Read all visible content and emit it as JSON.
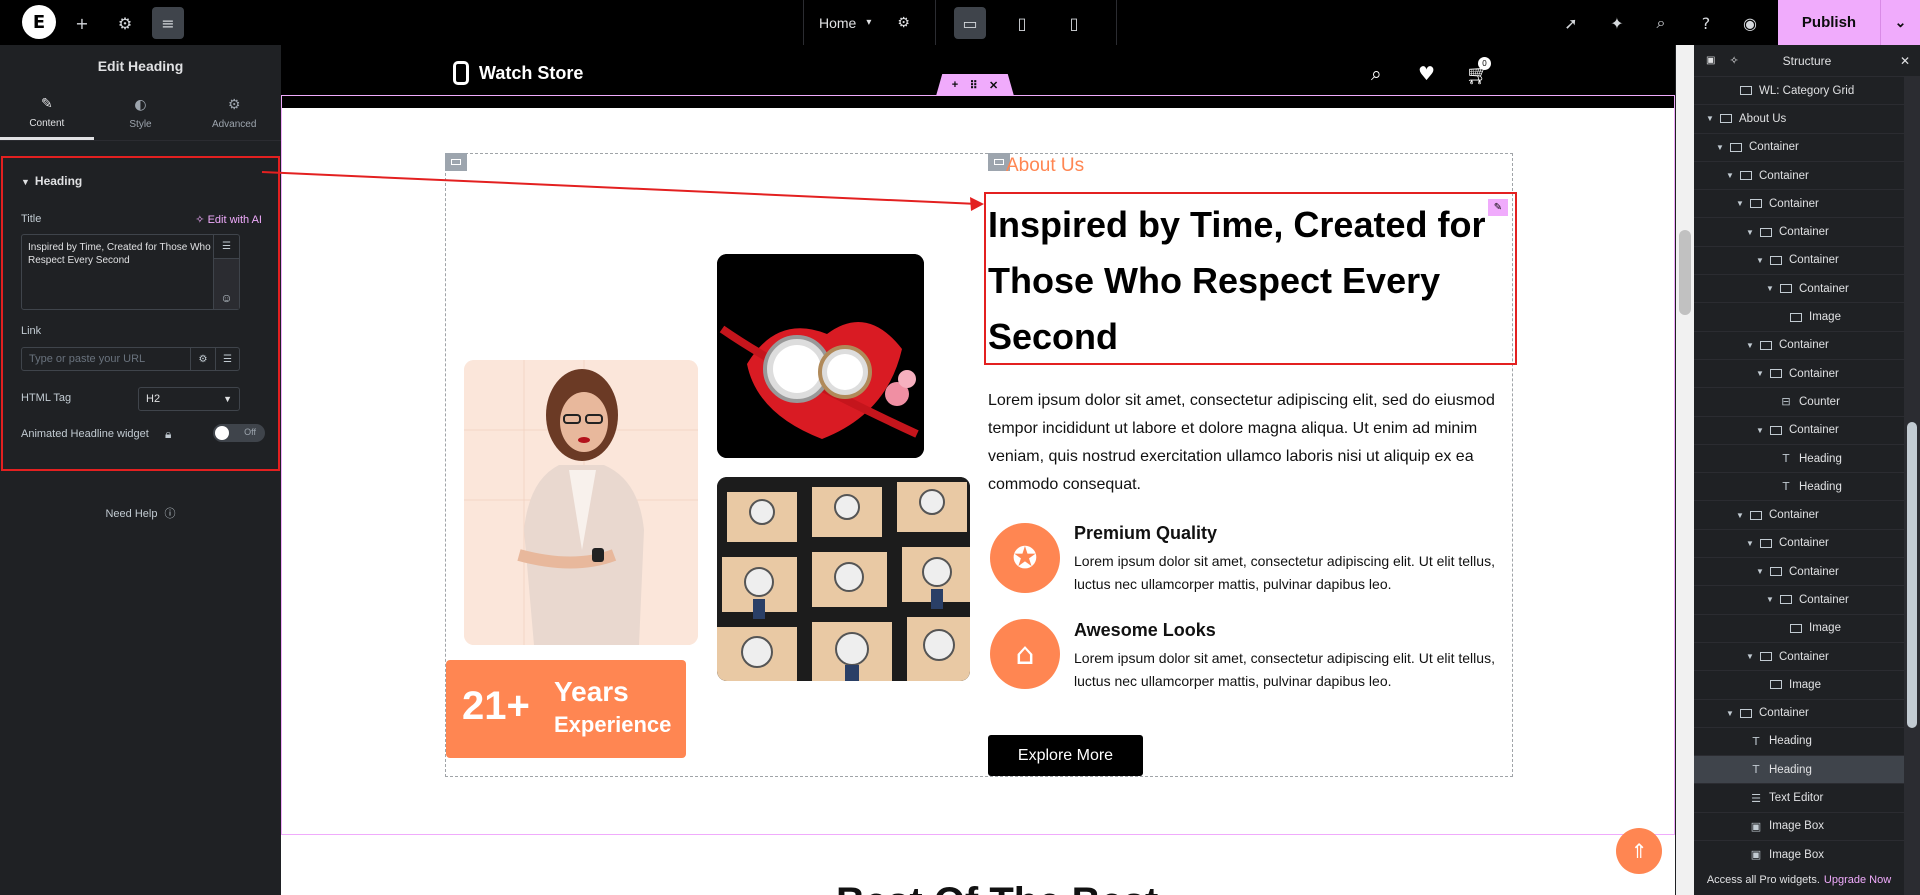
{
  "topbar": {
    "home_label": "Home",
    "publish_label": "Publish"
  },
  "left_panel": {
    "title": "Edit Heading",
    "tabs": [
      {
        "label": "Content",
        "icon": "pencil-icon"
      },
      {
        "label": "Style",
        "icon": "half-circle-icon"
      },
      {
        "label": "Advanced",
        "icon": "gear-icon"
      }
    ],
    "section_title": "Heading",
    "title_label": "Title",
    "edit_ai_label": "Edit with AI",
    "title_value": "Inspired by Time, Created for Those Who Respect Every Second",
    "link_label": "Link",
    "link_placeholder": "Type or paste your URL",
    "html_tag_label": "HTML Tag",
    "html_tag_value": "H2",
    "animated_label": "Animated Headline widget",
    "toggle_label": "Off",
    "need_help": "Need Help"
  },
  "site": {
    "brand": "Watch Store",
    "cart_count": "0",
    "about_tag": "About Us",
    "heading": "Inspired by Time, Created for Those Who Respect Every Second",
    "paragraph": "Lorem ipsum dolor sit amet, consectetur adipiscing elit, sed do eiusmod tempor incididunt ut labore et dolore magna aliqua. Ut enim ad minim veniam, quis nostrud exercitation ullamco laboris nisi ut aliquip ex ea commodo consequat.",
    "features": [
      {
        "title": "Premium Quality",
        "text": "Lorem ipsum dolor sit amet, consectetur adipiscing elit. Ut elit tellus, luctus nec ullamcorper mattis, pulvinar dapibus leo."
      },
      {
        "title": "Awesome Looks",
        "text": "Lorem ipsum dolor sit amet, consectetur adipiscing elit. Ut elit tellus, luctus nec ullamcorper mattis, pulvinar dapibus leo."
      }
    ],
    "button": "Explore More",
    "years_num": "21+",
    "years_l1": "Years",
    "years_l2": "Experience",
    "next_heading": "Best Of The Best"
  },
  "structure": {
    "title": "Structure",
    "nodes": [
      {
        "label": "WL: Category Grid"
      },
      {
        "label": "About Us"
      },
      {
        "label": "Container"
      },
      {
        "label": "Container"
      },
      {
        "label": "Container"
      },
      {
        "label": "Container"
      },
      {
        "label": "Container"
      },
      {
        "label": "Container"
      },
      {
        "label": "Image"
      },
      {
        "label": "Container"
      },
      {
        "label": "Container"
      },
      {
        "label": "Counter"
      },
      {
        "label": "Container"
      },
      {
        "label": "Heading"
      },
      {
        "label": "Heading"
      },
      {
        "label": "Container"
      },
      {
        "label": "Container"
      },
      {
        "label": "Container"
      },
      {
        "label": "Container"
      },
      {
        "label": "Image"
      },
      {
        "label": "Container"
      },
      {
        "label": "Image"
      },
      {
        "label": "Container"
      },
      {
        "label": "Heading"
      },
      {
        "label": "Heading"
      },
      {
        "label": "Text Editor"
      },
      {
        "label": "Image Box"
      },
      {
        "label": "Image Box"
      }
    ],
    "footer_text": "Access all Pro widgets.",
    "footer_link": "Upgrade Now"
  },
  "colors": {
    "accent": "#f0abfc",
    "orange": "#ff8652",
    "selection": "#e32020"
  }
}
